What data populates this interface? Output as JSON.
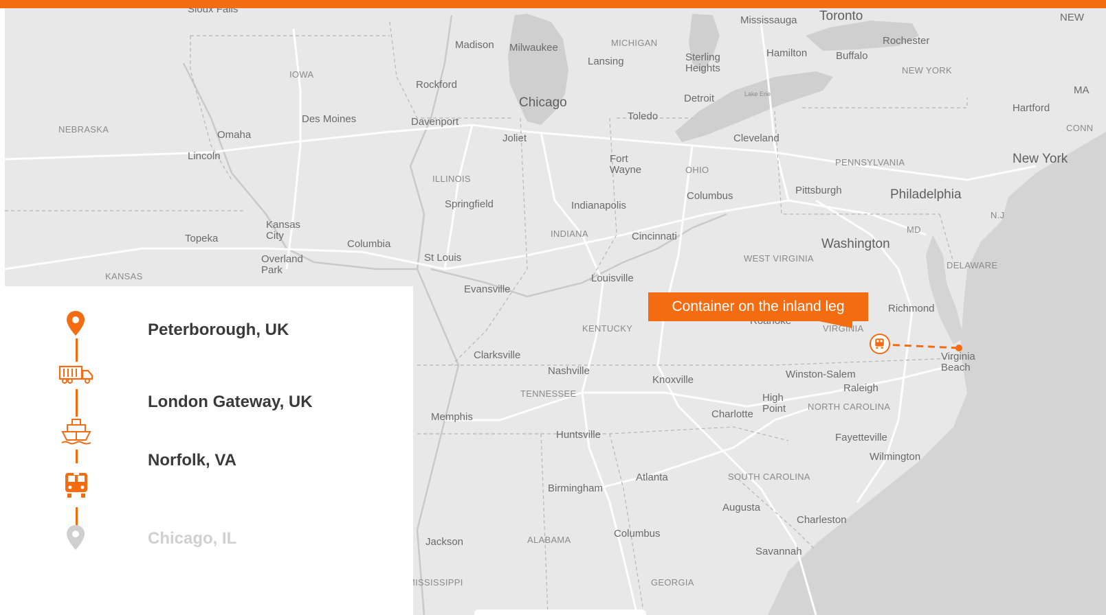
{
  "colors": {
    "accent": "#f36c12",
    "map_bg": "#e8e8e8",
    "muted": "#d0d0d0"
  },
  "map": {
    "callout": "Container on the inland leg",
    "labels": {
      "sioux_falls": "Sioux Falls",
      "madison": "Madison",
      "milwaukee": "Milwaukee",
      "michigan": "MICHIGAN",
      "lansing": "Lansing",
      "sterling_heights": "Sterling Heights",
      "mississauga": "Mississauga",
      "toronto": "Toronto",
      "hamilton": "Hamilton",
      "buffalo": "Buffalo",
      "rochester": "Rochester",
      "new_york_state": "NEW YORK",
      "iowa": "IOWA",
      "rockford": "Rockford",
      "chicago": "Chicago",
      "detroit": "Detroit",
      "lake_erie": "Lake Erie",
      "nebraska": "NEBRASKA",
      "omaha": "Omaha",
      "des_moines": "Des Moines",
      "davenport": "Davenport",
      "joliet": "Joliet",
      "toledo": "Toledo",
      "cleveland": "Cleveland",
      "hartford": "Hartford",
      "lincoln": "Lincoln",
      "illinois": "ILLINOIS",
      "fort_wayne": "Fort Wayne",
      "ohio": "OHIO",
      "pennsylvania": "PENNSYLVANIA",
      "new_york_city": "New York",
      "springfield": "Springfield",
      "indianapolis": "Indianapolis",
      "columbus_oh": "Columbus",
      "pittsburgh": "Pittsburgh",
      "philadelphia": "Philadelphia",
      "nj": "N.J",
      "kansas_city": "Kansas City",
      "topeka": "Topeka",
      "columbia": "Columbia",
      "indiana": "INDIANA",
      "cincinnati": "Cincinnati",
      "md": "MD",
      "washington": "Washington",
      "overland_park": "Overland Park",
      "st_louis": "St Louis",
      "west_virginia": "WEST VIRGINIA",
      "delaware": "DELAWARE",
      "kansas": "KANSAS",
      "louisville": "Louisville",
      "evansville": "Evansville",
      "richmond": "Richmond",
      "roanoke": "Roanoke",
      "kentucky": "KENTUCKY",
      "virginia": "VIRGINIA",
      "clarksville": "Clarksville",
      "virginia_beach": "Virginia Beach",
      "nashville": "Nashville",
      "knoxville": "Knoxville",
      "winston_salem": "Winston-Salem",
      "tennessee": "TENNESSEE",
      "raleigh": "Raleigh",
      "high_point": "High Point",
      "memphis": "Memphis",
      "charlotte": "Charlotte",
      "north_carolina": "NORTH CAROLINA",
      "huntsville": "Huntsville",
      "fayetteville": "Fayetteville",
      "wilmington": "Wilmington",
      "atlanta": "Atlanta",
      "south_carolina": "SOUTH CAROLINA",
      "birmingham": "Birmingham",
      "augusta": "Augusta",
      "charleston": "Charleston",
      "jackson": "Jackson",
      "alabama": "ALABAMA",
      "columbus_ga": "Columbus",
      "savannah": "Savannah",
      "mississippi": "MISSISSIPPI",
      "georgia": "GEORGIA",
      "ma": "MA",
      "conn": "CONN",
      "new_cut": "NEW"
    }
  },
  "route": {
    "stops": [
      {
        "label": "Peterborough, UK",
        "icon": "location-pin-icon"
      },
      {
        "label": "London Gateway, UK",
        "icon": "truck-icon"
      },
      {
        "label": "Norfolk, VA",
        "icon": "ship-icon"
      },
      {
        "label": "Chicago, IL",
        "icon": "train-icon"
      }
    ]
  }
}
